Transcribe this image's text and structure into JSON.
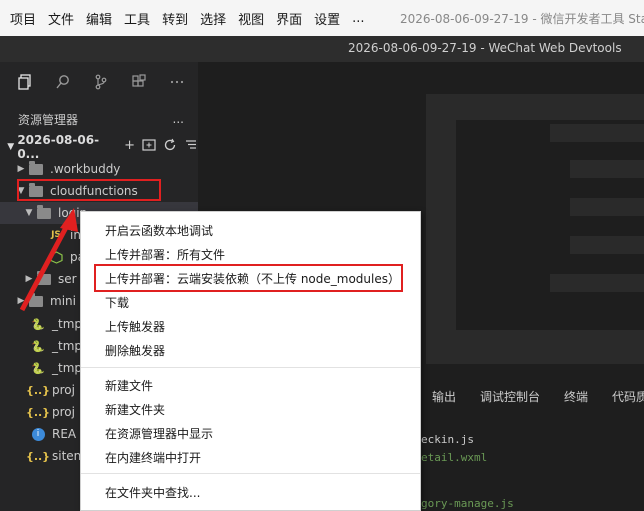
{
  "menubar": {
    "items": [
      "项目",
      "文件",
      "编辑",
      "工具",
      "转到",
      "选择",
      "视图",
      "界面",
      "设置",
      "..."
    ],
    "app_title": "2026-08-06-09-27-19 - 微信开发者工具 Sta"
  },
  "titlebar": {
    "title": "2026-08-06-09-27-19 - WeChat Web Devtools"
  },
  "activity_bar": {
    "icons": [
      "files-icon",
      "search-icon",
      "source-control-icon",
      "extensions-icon",
      "more-icon"
    ]
  },
  "sidebar": {
    "header": "资源管理器",
    "header_more": "...",
    "project_name": "2026-08-06-0...",
    "tree": [
      {
        "label": ".workbuddy",
        "type": "folder",
        "level": 1,
        "expanded": false
      },
      {
        "label": "cloudfunctions",
        "type": "folder",
        "level": 1,
        "expanded": true
      },
      {
        "label": "login",
        "type": "folder",
        "level": 2,
        "expanded": true
      },
      {
        "label": "in",
        "type": "file-js",
        "level": 3
      },
      {
        "label": "pa",
        "type": "file-pkg",
        "level": 3
      },
      {
        "label": "ser",
        "type": "folder",
        "level": 2,
        "expanded": false
      },
      {
        "label": "mini",
        "type": "folder",
        "level": 1,
        "expanded": false
      },
      {
        "label": "_tmp",
        "type": "python",
        "level": 1
      },
      {
        "label": "_tmp",
        "type": "python",
        "level": 1
      },
      {
        "label": "_tmp",
        "type": "python",
        "level": 1
      },
      {
        "label": "proj",
        "type": "json",
        "level": 1
      },
      {
        "label": "proj",
        "type": "json",
        "level": 1
      },
      {
        "label": "REA",
        "type": "info",
        "level": 1
      },
      {
        "label": "siten",
        "type": "json",
        "level": 1
      }
    ]
  },
  "context_menu": {
    "items": [
      "开启云函数本地调试",
      "上传并部署：所有文件",
      "上传并部署：云端安装依赖（不上传 node_modules）",
      "下载",
      "上传触发器",
      "删除触发器",
      "新建文件",
      "新建文件夹",
      "在资源管理器中显示",
      "在内建终端中打开",
      "在文件夹中查找..."
    ]
  },
  "panel": {
    "tabs": [
      "输出",
      "调试控制台",
      "终端",
      "代码质量"
    ]
  },
  "editor_lines": [
    "eckin.js",
    "etail.wxml",
    "gory-manage.js"
  ],
  "colors": {
    "highlight": "#e02020",
    "menu_bg": "#ffffff",
    "sidebar_bg": "#252526"
  }
}
